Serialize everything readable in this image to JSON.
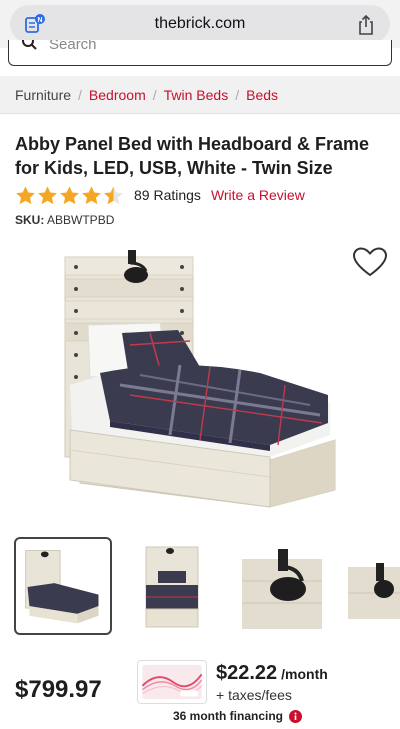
{
  "browser": {
    "url": "thebrick.com",
    "tab_icon": "tab-overview-icon",
    "share_icon": "share-icon"
  },
  "search": {
    "placeholder": "Search",
    "icon": "search-icon"
  },
  "breadcrumb": {
    "items": [
      "Furniture",
      "Bedroom",
      "Twin Beds",
      "Beds"
    ]
  },
  "product": {
    "title": "Abby Panel Bed with Headboard & Frame for Kids, LED, USB, White - Twin Size",
    "rating_value": 4.5,
    "rating_max": 5,
    "ratings_count": "89 Ratings",
    "write_review": "Write a Review",
    "sku_label": "SKU:",
    "sku_value": "ABBWTPBD",
    "wishlist_icon": "heart-icon"
  },
  "gallery": {
    "thumbnails": [
      "bed-full-view",
      "bed-front-view",
      "lamp-closeup",
      "lamp-side"
    ],
    "selected_index": 0
  },
  "pricing": {
    "price": "$799.97",
    "monthly": "$22.22",
    "monthly_suffix": "/month",
    "taxes": "+ taxes/fees",
    "financing": "36 month financing",
    "info_icon": "info-icon"
  },
  "colors": {
    "accent": "#c8102e",
    "star": "#f5a623"
  }
}
